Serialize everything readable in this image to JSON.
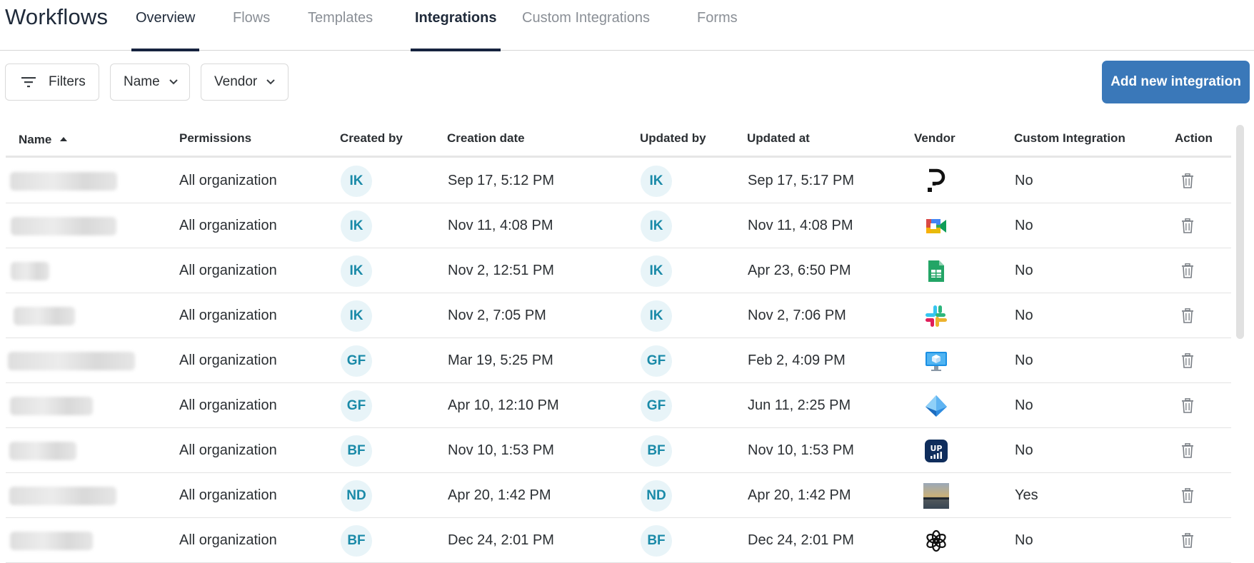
{
  "app": {
    "title": "Workflows"
  },
  "tabs": [
    {
      "label": "Overview",
      "active": true
    },
    {
      "label": "Flows",
      "active": false
    },
    {
      "label": "Templates",
      "active": false
    },
    {
      "label": "Integrations",
      "active": true
    },
    {
      "label": "Custom Integrations",
      "active": false
    },
    {
      "label": "Forms",
      "active": false
    }
  ],
  "toolbar": {
    "filters_label": "Filters",
    "name_label": "Name",
    "vendor_label": "Vendor",
    "add_label": "Add new integration"
  },
  "table": {
    "columns": [
      "Name",
      "Permissions",
      "Created by",
      "Creation date",
      "Updated by",
      "Updated at",
      "Vendor",
      "Custom Integration",
      "Action"
    ],
    "sort": {
      "column": "Name",
      "direction": "asc"
    },
    "rows": [
      {
        "permissions": "All organization",
        "created_by": "IK",
        "creation_date": "Sep 17, 5:12 PM",
        "updated_by": "IK",
        "updated_at": "Sep 17, 5:17 PM",
        "vendor_icon": "pendo-icon",
        "custom": "No"
      },
      {
        "permissions": "All organization",
        "created_by": "IK",
        "creation_date": "Nov 11, 4:08 PM",
        "updated_by": "IK",
        "updated_at": "Nov 11, 4:08 PM",
        "vendor_icon": "google-meet-icon",
        "custom": "No"
      },
      {
        "permissions": "All organization",
        "created_by": "IK",
        "creation_date": "Nov 2, 12:51 PM",
        "updated_by": "IK",
        "updated_at": "Apr 23, 6:50 PM",
        "vendor_icon": "google-sheets-icon",
        "custom": "No"
      },
      {
        "permissions": "All organization",
        "created_by": "IK",
        "creation_date": "Nov 2, 7:05 PM",
        "updated_by": "IK",
        "updated_at": "Nov 2, 7:06 PM",
        "vendor_icon": "slack-icon",
        "custom": "No"
      },
      {
        "permissions": "All organization",
        "created_by": "GF",
        "creation_date": "Mar 19, 5:25 PM",
        "updated_by": "GF",
        "updated_at": "Feb 2, 4:09 PM",
        "vendor_icon": "virtual-desktop-icon",
        "custom": "No"
      },
      {
        "permissions": "All organization",
        "created_by": "GF",
        "creation_date": "Apr 10, 12:10 PM",
        "updated_by": "GF",
        "updated_at": "Jun 11, 2:25 PM",
        "vendor_icon": "azure-ad-icon",
        "custom": "No"
      },
      {
        "permissions": "All organization",
        "created_by": "BF",
        "creation_date": "Nov 10, 1:53 PM",
        "updated_by": "BF",
        "updated_at": "Nov 10, 1:53 PM",
        "vendor_icon": "uptime-icon",
        "custom": "No"
      },
      {
        "permissions": "All organization",
        "created_by": "ND",
        "creation_date": "Apr 20, 1:42 PM",
        "updated_by": "ND",
        "updated_at": "Apr 20, 1:42 PM",
        "vendor_icon": "custom-photo-icon",
        "custom": "Yes"
      },
      {
        "permissions": "All organization",
        "created_by": "BF",
        "creation_date": "Dec 24, 2:01 PM",
        "updated_by": "BF",
        "updated_at": "Dec 24, 2:01 PM",
        "vendor_icon": "openai-icon",
        "custom": "No"
      }
    ]
  },
  "colors": {
    "primary": "#3a78b9",
    "avatar_bg": "#e8f4f8",
    "avatar_text": "#1a8aa8",
    "tab_active": "#16233f"
  }
}
